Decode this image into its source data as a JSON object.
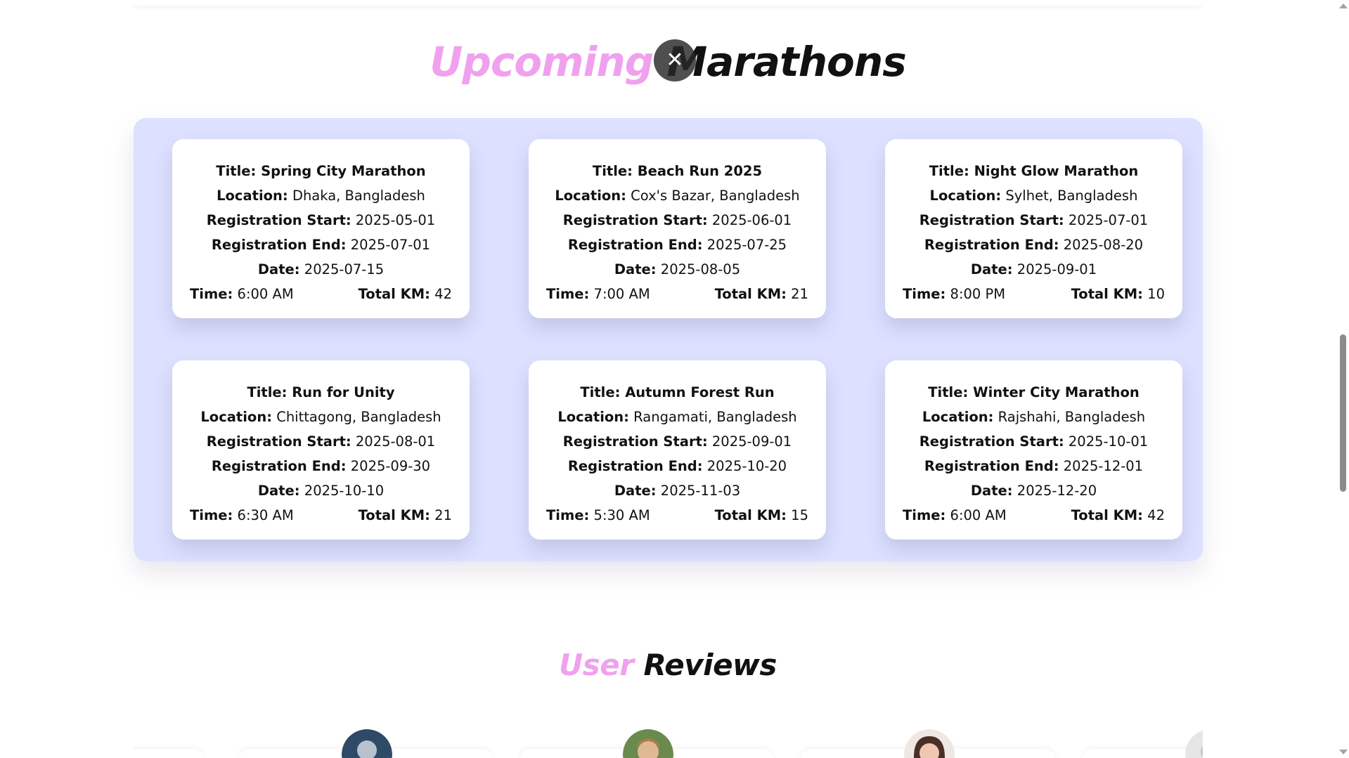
{
  "upcoming": {
    "title_accent": "Upcoming",
    "title_rest": " Marathons"
  },
  "close_button": {
    "icon": "close-icon",
    "glyph": "✕"
  },
  "labels": {
    "title": "Title:",
    "location": "Location:",
    "reg_start": "Registration Start:",
    "reg_end": "Registration End:",
    "date": "Date:",
    "time": "Time:",
    "total_km": "Total KM:"
  },
  "marathons": [
    {
      "title": "Spring City Marathon",
      "location": "Dhaka, Bangladesh",
      "reg_start": "2025-05-01",
      "reg_end": "2025-07-01",
      "date": "2025-07-15",
      "time": "6:00 AM",
      "total_km": "42"
    },
    {
      "title": "Beach Run 2025",
      "location": "Cox's Bazar, Bangladesh",
      "reg_start": "2025-06-01",
      "reg_end": "2025-07-25",
      "date": "2025-08-05",
      "time": "7:00 AM",
      "total_km": "21"
    },
    {
      "title": "Night Glow Marathon",
      "location": "Sylhet, Bangladesh",
      "reg_start": "2025-07-01",
      "reg_end": "2025-08-20",
      "date": "2025-09-01",
      "time": "8:00 PM",
      "total_km": "10"
    },
    {
      "title": "Run for Unity",
      "location": "Chittagong, Bangladesh",
      "reg_start": "2025-08-01",
      "reg_end": "2025-09-30",
      "date": "2025-10-10",
      "time": "6:30 AM",
      "total_km": "21"
    },
    {
      "title": "Autumn Forest Run",
      "location": "Rangamati, Bangladesh",
      "reg_start": "2025-09-01",
      "reg_end": "2025-10-20",
      "date": "2025-11-03",
      "time": "5:30 AM",
      "total_km": "15"
    },
    {
      "title": "Winter City Marathon",
      "location": "Rajshahi, Bangladesh",
      "reg_start": "2025-10-01",
      "reg_end": "2025-12-01",
      "date": "2025-12-20",
      "time": "6:00 AM",
      "total_km": "42"
    }
  ],
  "reviews": {
    "title_accent": "User",
    "title_rest": " Reviews"
  },
  "colors": {
    "accent": "#f0a1ee",
    "panel_bg": "#dde1ff",
    "card_bg": "#ffffff",
    "close_bg": "#2b2b2b"
  }
}
